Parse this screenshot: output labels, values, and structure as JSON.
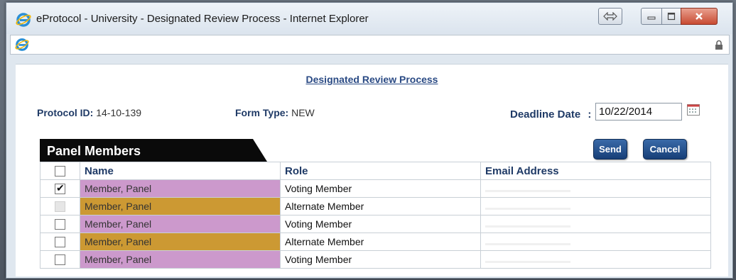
{
  "window": {
    "title": "eProtocol - University - Designated Review Process - Internet Explorer"
  },
  "page": {
    "title": "Designated Review Process",
    "protocol_id_label": "Protocol ID:",
    "protocol_id_value": "14-10-139",
    "form_type_label": "Form Type:",
    "form_type_value": "NEW",
    "deadline_label": "Deadline Date",
    "deadline_separator": ":",
    "deadline_value": "10/22/2014"
  },
  "panel": {
    "heading": "Panel Members",
    "send_label": "Send",
    "cancel_label": "Cancel",
    "columns": [
      "Name",
      "Role",
      "Email Address"
    ],
    "rows": [
      {
        "name": "Member, Panel",
        "role": "Voting Member",
        "email": "",
        "checked": true,
        "disabled": false,
        "color": "#cc99cc"
      },
      {
        "name": "Member, Panel",
        "role": "Alternate Member",
        "email": "",
        "checked": false,
        "disabled": true,
        "color": "#cc9933"
      },
      {
        "name": "Member, Panel",
        "role": "Voting Member",
        "email": "",
        "checked": false,
        "disabled": false,
        "color": "#cc99cc"
      },
      {
        "name": "Member, Panel",
        "role": "Alternate Member",
        "email": "",
        "checked": false,
        "disabled": false,
        "color": "#cc9933"
      },
      {
        "name": "Member, Panel",
        "role": "Voting Member",
        "email": "",
        "checked": false,
        "disabled": false,
        "color": "#cc99cc"
      }
    ]
  },
  "colors": {
    "voting": "#cc99cc",
    "alternate": "#cc9933",
    "link": "#2a4a84",
    "button": "#1f4a86"
  }
}
